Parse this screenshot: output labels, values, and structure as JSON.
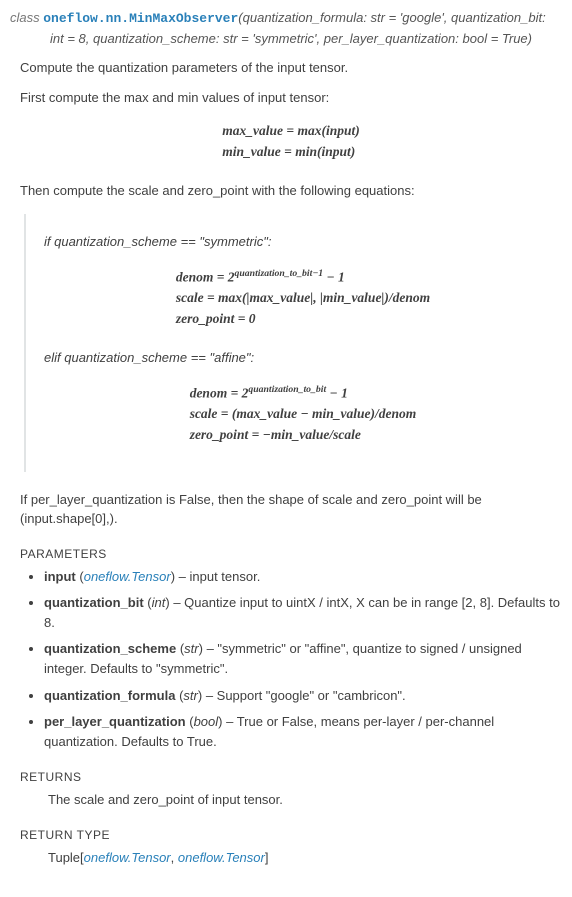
{
  "signature": {
    "class_keyword": "class",
    "classname": "oneflow.nn.MinMaxObserver",
    "params": "(quantization_formula: str = 'google', quantization_bit: int = 8, quantization_scheme: str = 'symmetric', per_layer_quantization: bool = True)"
  },
  "intro": {
    "p1": "Compute the quantization parameters of the input tensor.",
    "p2": "First compute the max and min values of input tensor:"
  },
  "math1": {
    "l1": "max_value = max(input)",
    "l2": "min_value = min(input)"
  },
  "then": "Then compute the scale and zero_point with the following equations:",
  "quote": {
    "if_line": "if quantization_scheme == \"symmetric\":",
    "sym": {
      "denom_pre": "denom = 2",
      "denom_sup": "quantization_to_bit−1",
      "denom_post": " − 1",
      "scale": "scale = max(|max_value|, |min_value|)/denom",
      "zp": "zero_point = 0"
    },
    "elif_line": "elif quantization_scheme == \"affine\":",
    "aff": {
      "denom_pre": "denom = 2",
      "denom_sup": "quantization_to_bit",
      "denom_post": " − 1",
      "scale": "scale = (max_value − min_value)/denom",
      "zp": "zero_point = −min_value/scale"
    }
  },
  "after_quote": "If per_layer_quantization is False, then the shape of scale and zero_point will be (input.shape[0],).",
  "labels": {
    "params": "PARAMETERS",
    "returns": "RETURNS",
    "rtype": "RETURN TYPE"
  },
  "params": {
    "input": {
      "name": "input",
      "type": "oneflow.Tensor",
      "link": true,
      "desc": " – input tensor."
    },
    "qbit": {
      "name": "quantization_bit",
      "type": "int",
      "link": false,
      "desc": " – Quantize input to uintX / intX, X can be in range [2, 8]. Defaults to 8."
    },
    "qscheme": {
      "name": "quantization_scheme",
      "type": "str",
      "link": false,
      "desc": " – \"symmetric\" or \"affine\", quantize to signed / unsigned integer. Defaults to \"symmetric\"."
    },
    "qformula": {
      "name": "quantization_formula",
      "type": "str",
      "link": false,
      "desc": " – Support \"google\" or \"cambricon\"."
    },
    "plq": {
      "name": "per_layer_quantization",
      "type": "bool",
      "link": false,
      "desc": " – True or False, means per-layer / per-channel quantization. Defaults to True."
    }
  },
  "returns_text": "The scale and zero_point of input tensor.",
  "rtype": {
    "pre": "Tuple[",
    "t1": "oneflow.Tensor",
    "sep": ", ",
    "t2": "oneflow.Tensor",
    "post": "]"
  }
}
